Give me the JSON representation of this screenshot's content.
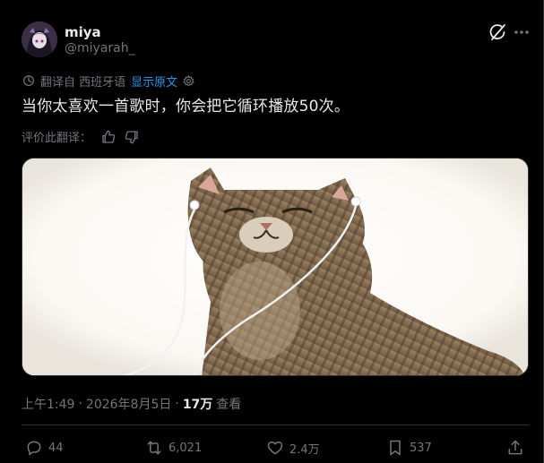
{
  "author": {
    "name": "miya",
    "handle": "@miyarah_"
  },
  "translation": {
    "translated_from": "翻译自 西班牙语",
    "show_original": "显示原文"
  },
  "post": {
    "text": "当你太喜欢一首歌时，你会把它循环播放50次。"
  },
  "rating": {
    "label": "评价此翻译："
  },
  "meta": {
    "time": "上午1:49",
    "separator": "·",
    "date": "2026年8月5日",
    "separator2": "·",
    "views": "17万",
    "views_label": "查看"
  },
  "actions": {
    "replies": "44",
    "reposts": "6,021",
    "likes": "2.4万",
    "bookmarks": "537"
  },
  "colors": {
    "background": "#000000",
    "text_primary": "#e7e9ea",
    "text_secondary": "#71767b",
    "link": "#1d9bf0",
    "border": "#2f3336"
  },
  "icons": {
    "grok": "grok-icon",
    "more": "more-icon",
    "translate": "translate-icon",
    "settings": "gear-icon",
    "thumbs_up": "thumbs-up-icon",
    "thumbs_down": "thumbs-down-icon",
    "reply": "reply-icon",
    "repost": "repost-icon",
    "like": "heart-icon",
    "bookmark": "bookmark-icon",
    "share": "share-icon"
  }
}
